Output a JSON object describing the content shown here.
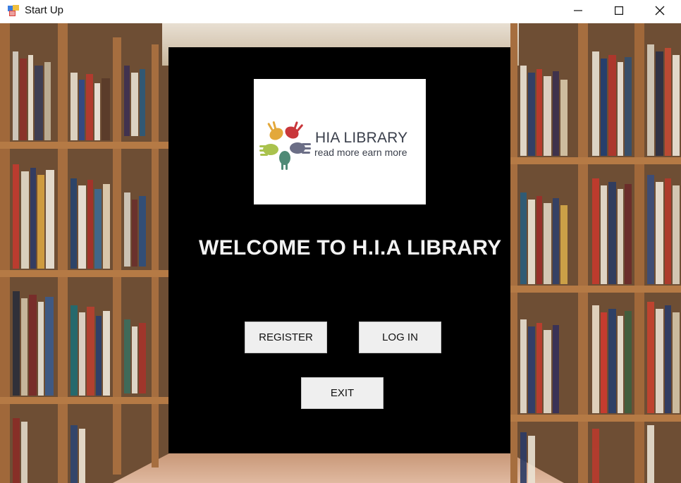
{
  "window": {
    "title": "Start Up",
    "icons": [
      "app-form-icon",
      "minimize-icon",
      "maximize-icon",
      "close-icon"
    ]
  },
  "logo": {
    "title": "HIA LIBRARY",
    "tagline": "read more earn more",
    "hand_colors": [
      "#e3a83b",
      "#c9373b",
      "#6b6e86",
      "#4f8a76",
      "#a9c24d"
    ]
  },
  "welcome_text": "WELCOME TO H.I.A LIBRARY",
  "buttons": {
    "register": "REGISTER",
    "login": "LOG IN",
    "exit": "EXIT"
  }
}
